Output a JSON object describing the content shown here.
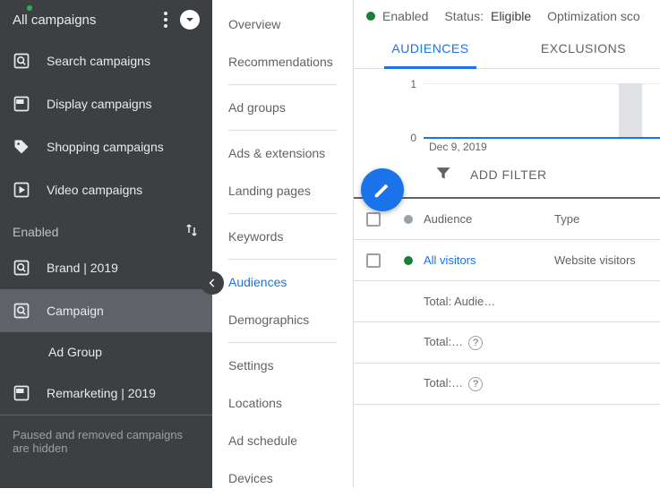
{
  "sidebar": {
    "title": "All campaigns",
    "items": [
      {
        "label": "Search campaigns",
        "icon": "search"
      },
      {
        "label": "Display campaigns",
        "icon": "display"
      },
      {
        "label": "Shopping campaigns",
        "icon": "tag"
      },
      {
        "label": "Video campaigns",
        "icon": "video"
      }
    ],
    "enabled_label": "Enabled",
    "campaigns": [
      {
        "label": "Brand | 2019",
        "icon": "search",
        "badge": true
      },
      {
        "label": "Campaign",
        "icon": "search",
        "badge": true,
        "selected": true
      },
      {
        "label": "Ad Group",
        "sub": true
      },
      {
        "label": "Remarketing | 2019",
        "icon": "display",
        "badge": true
      }
    ],
    "note": "Paused and removed campaigns are hidden"
  },
  "midnav": {
    "items": [
      "Overview",
      "Recommendations",
      "Ad groups",
      "Ads & extensions",
      "Landing pages",
      "Keywords",
      "Audiences",
      "Demographics",
      "Settings",
      "Locations",
      "Ad schedule",
      "Devices"
    ],
    "active": "Audiences",
    "dividers_after": [
      "Recommendations",
      "Ad groups",
      "Landing pages",
      "Keywords",
      "Demographics"
    ]
  },
  "status": {
    "enabled_label": "Enabled",
    "status_key": "Status:",
    "status_val": "Eligible",
    "opt_label": "Optimization sco"
  },
  "tabs": {
    "audiences": "AUDIENCES",
    "exclusions": "EXCLUSIONS"
  },
  "chart_data": {
    "type": "line",
    "title": "",
    "xlabel": "",
    "ylabel": "",
    "ylim": [
      0,
      1
    ],
    "yticks": [
      0,
      1
    ],
    "x": [
      "Dec 9, 2019"
    ],
    "series": [
      {
        "name": "",
        "values": [
          0
        ]
      }
    ],
    "date_label": "Dec 9, 2019"
  },
  "filter": {
    "label": "ADD FILTER"
  },
  "table": {
    "headers": {
      "audience": "Audience",
      "type": "Type"
    },
    "rows": [
      {
        "audience": "All visitors",
        "type": "Website visitors",
        "green": true,
        "link": true
      },
      {
        "audience": "Total: Audie…",
        "type": "",
        "summary": true
      },
      {
        "audience": "Total:…",
        "type": "",
        "summary": true,
        "help": true
      },
      {
        "audience": "Total:…",
        "type": "",
        "summary": true,
        "help": true
      }
    ]
  }
}
